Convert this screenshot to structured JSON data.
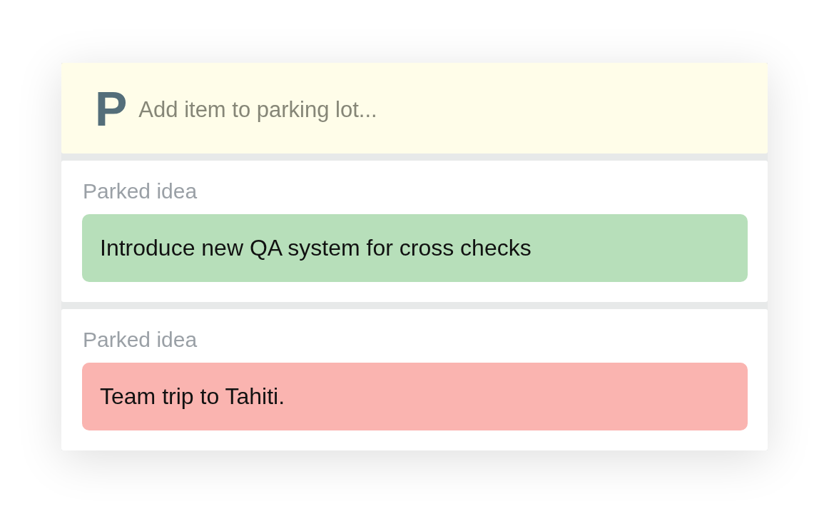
{
  "input_bar": {
    "logo": "P",
    "placeholder": "Add item to parking lot..."
  },
  "cards": [
    {
      "label": "Parked idea",
      "text": "Introduce new QA system for cross checks",
      "color": "#b7dfba"
    },
    {
      "label": "Parked idea",
      "text": "Team trip to Tahiti.",
      "color": "#fab4b0"
    }
  ]
}
